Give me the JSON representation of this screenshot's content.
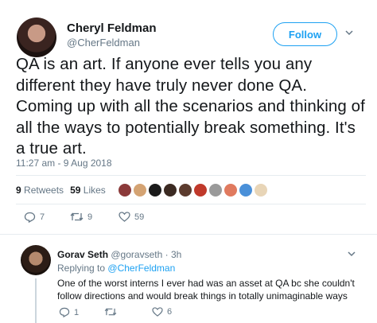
{
  "tweet": {
    "author_name": "Cheryl Feldman",
    "author_handle": "@CherFeldman",
    "follow_label": "Follow",
    "text": "QA is an art.  If anyone ever tells you any different they have truly never done QA. Coming up with all the scenarios and thinking of all the ways to potentially break something.  It's a true art.",
    "timestamp": "11:27 am - 9 Aug 2018",
    "retweets_count": "9",
    "retweets_label": "Retweets",
    "likes_count": "59",
    "likes_label": "Likes",
    "actions": {
      "reply_count": "7",
      "retweet_count": "9",
      "like_count": "59"
    }
  },
  "reply": {
    "author_name": "Gorav Seth",
    "author_handle": "@goravseth",
    "time": "3h",
    "replying_prefix": "Replying to",
    "replying_to": "@CherFeldman",
    "text": "One of the worst interns I ever had was an asset at QA bc she couldn't follow directions and would break things in totally unimaginable ways",
    "actions": {
      "reply_count": "1",
      "retweet_count": "",
      "like_count": "6"
    }
  },
  "colors": {
    "accent": "#1da1f2",
    "muted": "#657786",
    "divider": "#e6ecf0"
  },
  "icons": [
    "reply-icon",
    "retweet-icon",
    "like-icon",
    "chevron-down-icon"
  ]
}
